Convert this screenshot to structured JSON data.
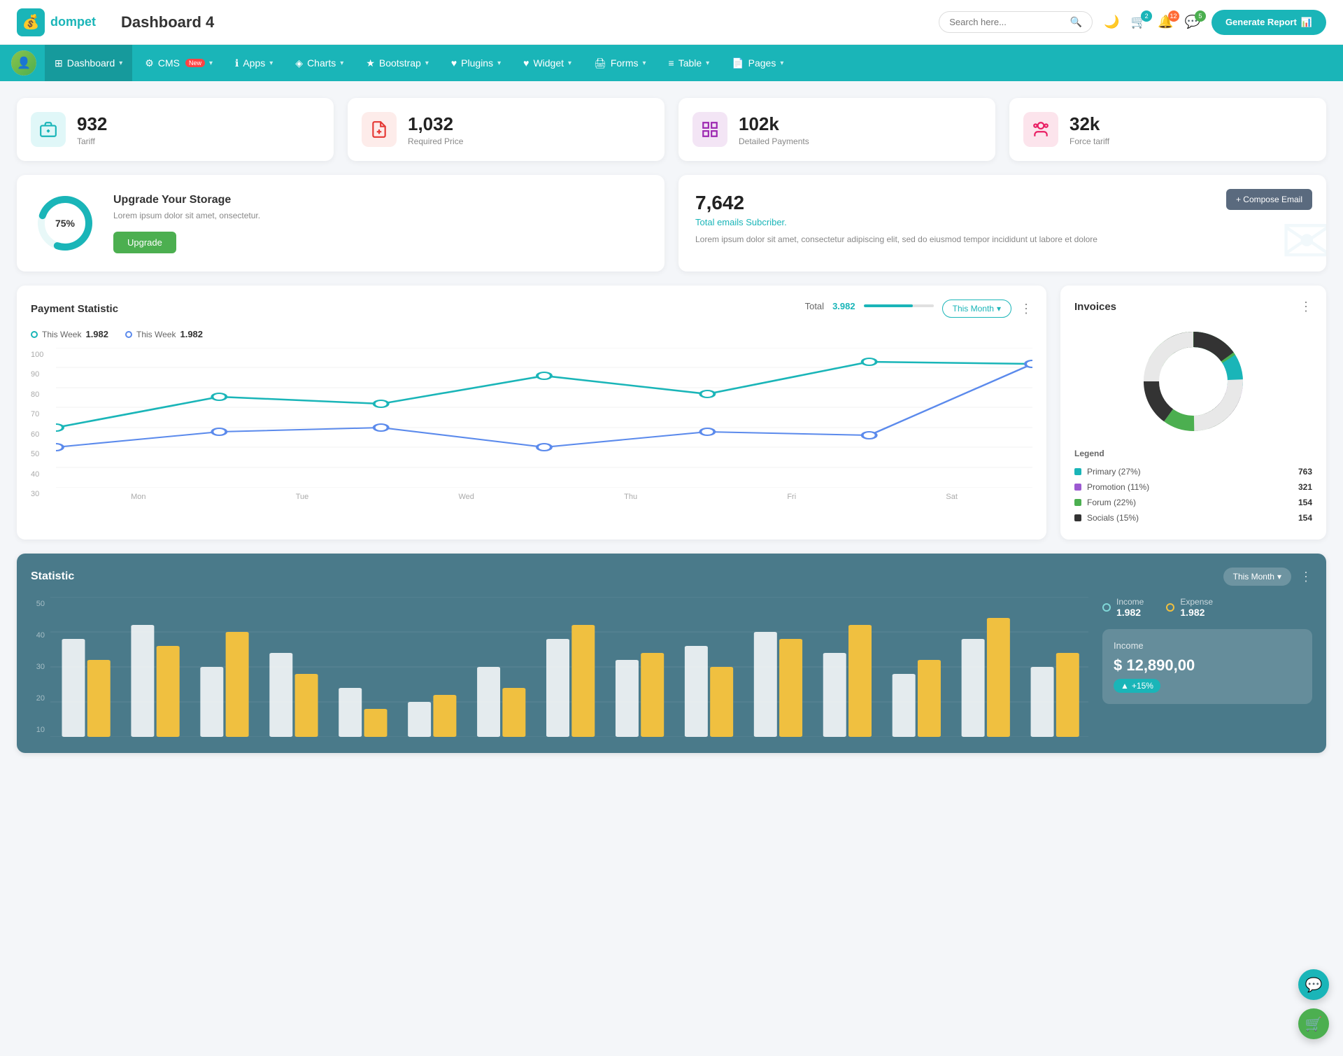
{
  "header": {
    "logo_text": "dompet",
    "page_title": "Dashboard 4",
    "search_placeholder": "Search here...",
    "generate_btn": "Generate Report",
    "icons": {
      "cart_badge": "2",
      "bell_badge": "12",
      "message_badge": "5"
    }
  },
  "navbar": {
    "items": [
      {
        "label": "Dashboard",
        "icon": "⊞",
        "active": true,
        "has_arrow": true
      },
      {
        "label": "CMS",
        "icon": "⚙",
        "badge": "New",
        "has_arrow": true
      },
      {
        "label": "Apps",
        "icon": "ℹ",
        "has_arrow": true
      },
      {
        "label": "Charts",
        "icon": "◈",
        "has_arrow": true
      },
      {
        "label": "Bootstrap",
        "icon": "★",
        "has_arrow": true
      },
      {
        "label": "Plugins",
        "icon": "♥",
        "has_arrow": true
      },
      {
        "label": "Widget",
        "icon": "♥",
        "has_arrow": true
      },
      {
        "label": "Forms",
        "icon": "🖨",
        "has_arrow": true
      },
      {
        "label": "Table",
        "icon": "≡",
        "has_arrow": true
      },
      {
        "label": "Pages",
        "icon": "📄",
        "has_arrow": true
      }
    ]
  },
  "stats": [
    {
      "value": "932",
      "label": "Tariff",
      "icon_type": "teal"
    },
    {
      "value": "1,032",
      "label": "Required Price",
      "icon_type": "red"
    },
    {
      "value": "102k",
      "label": "Detailed Payments",
      "icon_type": "purple"
    },
    {
      "value": "32k",
      "label": "Force tariff",
      "icon_type": "pink"
    }
  ],
  "storage": {
    "percent": "75%",
    "title": "Upgrade Your Storage",
    "description": "Lorem ipsum dolor sit amet, onsectetur.",
    "btn_label": "Upgrade",
    "donut_pct": 75
  },
  "email": {
    "count": "7,642",
    "subtitle": "Total emails Subcriber.",
    "description": "Lorem ipsum dolor sit amet, consectetur adipiscing elit, sed do eiusmod tempor incididunt ut labore et dolore",
    "compose_btn": "+ Compose Email"
  },
  "payment_chart": {
    "title": "Payment Statistic",
    "period_btn": "This Month",
    "legend": [
      {
        "label": "This Week",
        "value": "1.982",
        "color_class": "teal"
      },
      {
        "label": "This Week",
        "value": "1.982",
        "color_class": "blue"
      }
    ],
    "total_label": "Total",
    "total_value": "3.982",
    "total_bar_pct": 70,
    "x_labels": [
      "Mon",
      "Tue",
      "Wed",
      "Thu",
      "Fri",
      "Sat"
    ],
    "y_labels": [
      "100",
      "90",
      "80",
      "70",
      "60",
      "50",
      "40",
      "30"
    ]
  },
  "invoices": {
    "title": "Invoices",
    "legend": [
      {
        "label": "Primary (27%)",
        "value": "763",
        "color": "#1ab5b8"
      },
      {
        "label": "Promotion (11%)",
        "value": "321",
        "color": "#9c59d1"
      },
      {
        "label": "Forum (22%)",
        "value": "154",
        "color": "#4caf50"
      },
      {
        "label": "Socials (15%)",
        "value": "154",
        "color": "#333"
      }
    ]
  },
  "statistic": {
    "title": "Statistic",
    "period_btn": "This Month",
    "y_labels": [
      "50",
      "40",
      "30",
      "20",
      "10"
    ],
    "income": {
      "label": "Income",
      "value": "1.982"
    },
    "expense": {
      "label": "Expense",
      "value": "1.982"
    },
    "income_detail": {
      "label": "Income",
      "value": "$ 12,890,00",
      "change": "+15%"
    }
  }
}
